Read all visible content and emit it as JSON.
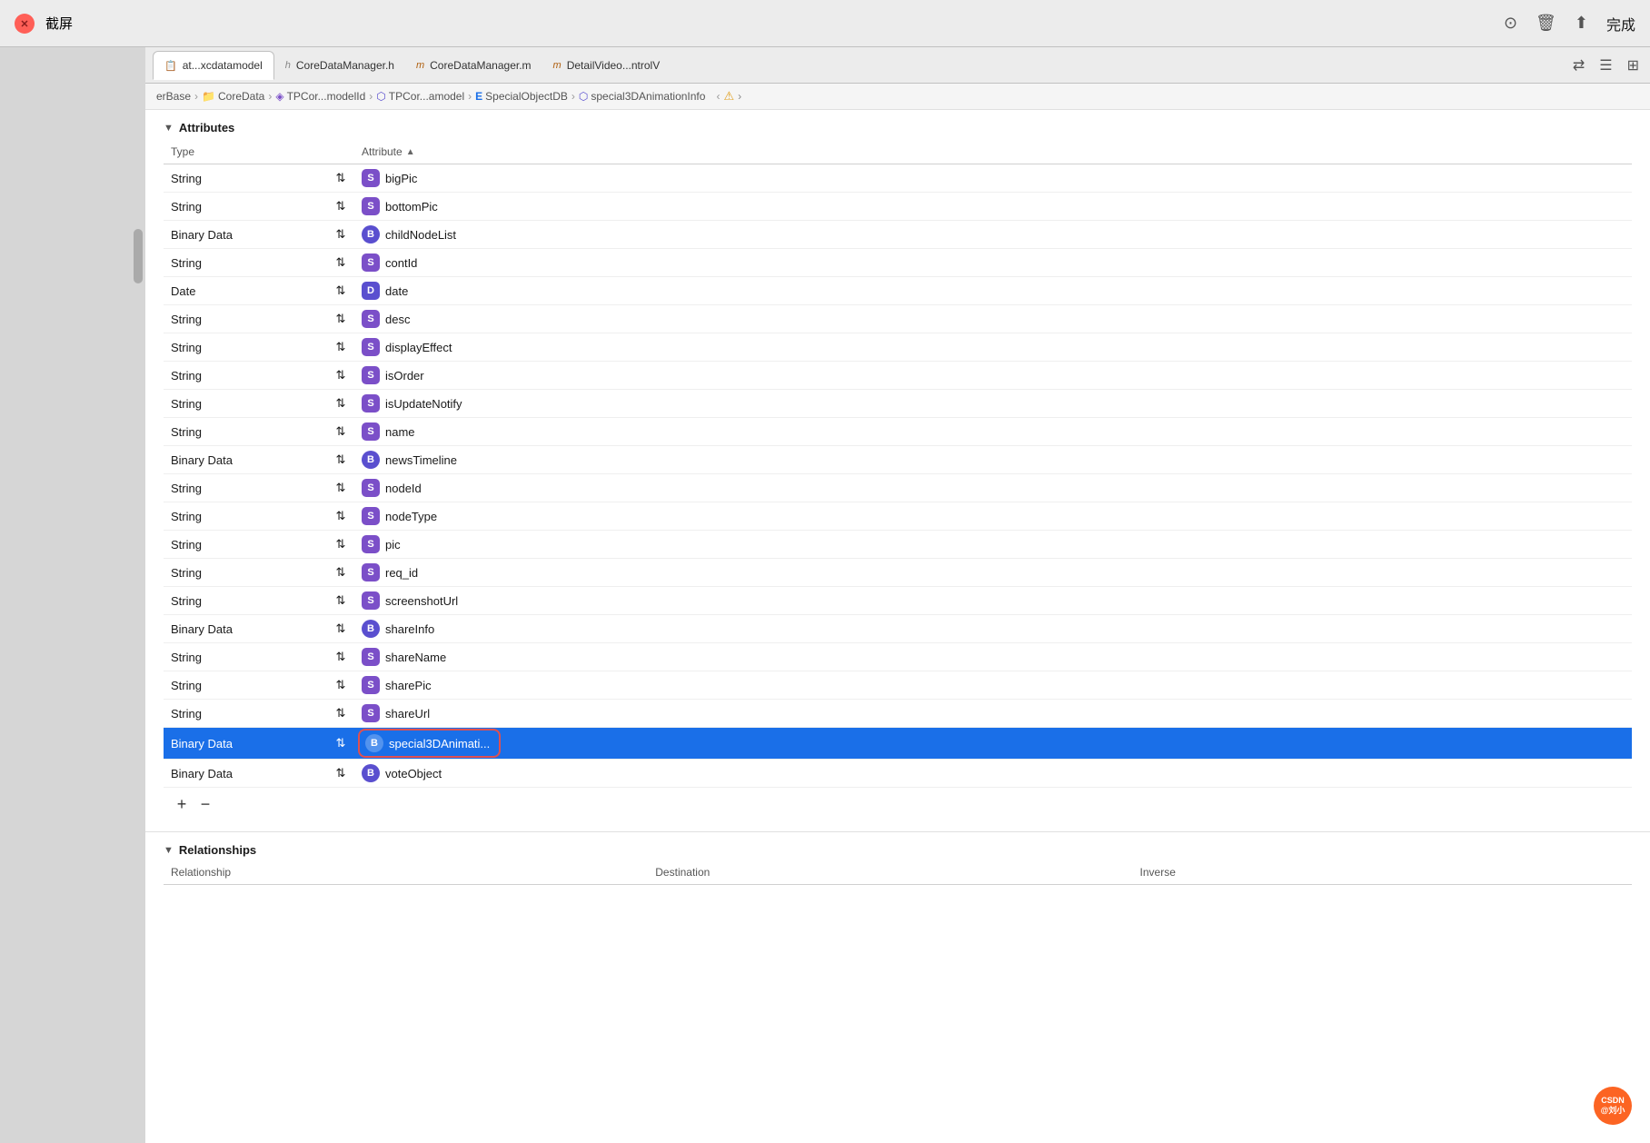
{
  "topBar": {
    "title": "截屏",
    "done": "完成"
  },
  "tabs": [
    {
      "label": "at...xcdatamodel",
      "icon": "📋",
      "active": true
    },
    {
      "label": "CoreDataManager.h",
      "icon": "h",
      "active": false
    },
    {
      "label": "CoreDataManager.m",
      "icon": "m",
      "active": false
    },
    {
      "label": "DetailVideo...ntrolV",
      "icon": "m",
      "active": false
    }
  ],
  "breadcrumb": [
    {
      "label": "erBase",
      "type": "text"
    },
    {
      "label": "CoreData",
      "type": "folder"
    },
    {
      "label": "TPCor...modelId",
      "type": "entity"
    },
    {
      "label": "TPCor...amodel",
      "type": "entity2"
    },
    {
      "label": "SpecialObjectDB",
      "type": "entity3"
    },
    {
      "label": "special3DAnimationInfo",
      "type": "entity4"
    }
  ],
  "sections": {
    "attributes": {
      "title": "Attributes",
      "columns": {
        "type": "Type",
        "attribute": "Attribute"
      },
      "rows": [
        {
          "type": "String",
          "badge": "S",
          "badgeType": "s",
          "name": "bigPic"
        },
        {
          "type": "String",
          "badge": "S",
          "badgeType": "s",
          "name": "bottomPic"
        },
        {
          "type": "Binary Data",
          "badge": "B",
          "badgeType": "b",
          "name": "childNodeList"
        },
        {
          "type": "String",
          "badge": "S",
          "badgeType": "s",
          "name": "contId"
        },
        {
          "type": "Date",
          "badge": "D",
          "badgeType": "d",
          "name": "date"
        },
        {
          "type": "String",
          "badge": "S",
          "badgeType": "s",
          "name": "desc"
        },
        {
          "type": "String",
          "badge": "S",
          "badgeType": "s",
          "name": "displayEffect"
        },
        {
          "type": "String",
          "badge": "S",
          "badgeType": "s",
          "name": "isOrder"
        },
        {
          "type": "String",
          "badge": "S",
          "badgeType": "s",
          "name": "isUpdateNotify"
        },
        {
          "type": "String",
          "badge": "S",
          "badgeType": "s",
          "name": "name"
        },
        {
          "type": "Binary Data",
          "badge": "B",
          "badgeType": "b",
          "name": "newsTimeline"
        },
        {
          "type": "String",
          "badge": "S",
          "badgeType": "s",
          "name": "nodeId"
        },
        {
          "type": "String",
          "badge": "S",
          "badgeType": "s",
          "name": "nodeType"
        },
        {
          "type": "String",
          "badge": "S",
          "badgeType": "s",
          "name": "pic"
        },
        {
          "type": "String",
          "badge": "S",
          "badgeType": "s",
          "name": "req_id"
        },
        {
          "type": "String",
          "badge": "S",
          "badgeType": "s",
          "name": "screenshotUrl"
        },
        {
          "type": "Binary Data",
          "badge": "B",
          "badgeType": "b",
          "name": "shareInfo"
        },
        {
          "type": "String",
          "badge": "S",
          "badgeType": "s",
          "name": "shareName"
        },
        {
          "type": "String",
          "badge": "S",
          "badgeType": "s",
          "name": "sharePic"
        },
        {
          "type": "String",
          "badge": "S",
          "badgeType": "s",
          "name": "shareUrl"
        },
        {
          "type": "Binary Data",
          "badge": "B",
          "badgeType": "b",
          "name": "special3DAnimati...",
          "selected": true
        },
        {
          "type": "Binary Data",
          "badge": "B",
          "badgeType": "b",
          "name": "voteObject"
        }
      ],
      "controls": {
        "add": "+",
        "remove": "−"
      }
    },
    "relationships": {
      "title": "Relationships",
      "columns": {
        "relationship": "Relationship",
        "destination": "Destination",
        "inverse": "Inverse"
      }
    }
  }
}
